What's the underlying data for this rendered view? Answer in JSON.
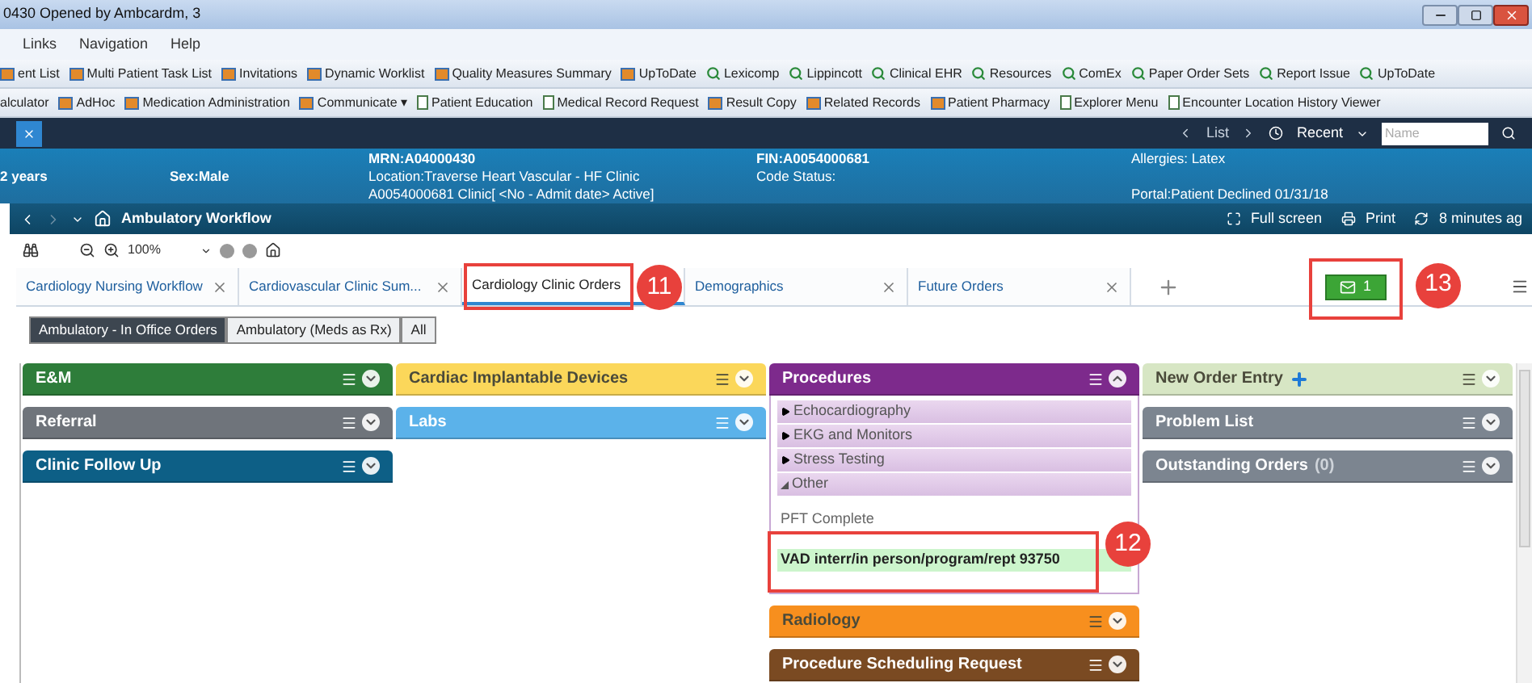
{
  "window": {
    "title": "0430 Opened by Ambcardm, 3"
  },
  "menu": [
    "Links",
    "Navigation",
    "Help"
  ],
  "toolbar_1": [
    {
      "label": "ent List",
      "kind": "app"
    },
    {
      "label": "Multi Patient Task List",
      "kind": "app"
    },
    {
      "label": "Invitations",
      "kind": "app"
    },
    {
      "label": "Dynamic Worklist",
      "kind": "app"
    },
    {
      "label": "Quality Measures Summary",
      "kind": "app"
    },
    {
      "label": "UpToDate",
      "kind": "app"
    },
    {
      "label": "Lexicomp",
      "kind": "link"
    },
    {
      "label": "Lippincott",
      "kind": "link"
    },
    {
      "label": "Clinical EHR",
      "kind": "link"
    },
    {
      "label": "Resources",
      "kind": "link"
    },
    {
      "label": "ComEx",
      "kind": "link"
    },
    {
      "label": "Paper Order Sets",
      "kind": "link"
    },
    {
      "label": "Report Issue",
      "kind": "link"
    },
    {
      "label": "UpToDate",
      "kind": "link"
    }
  ],
  "toolbar_2": [
    {
      "label": "alculator",
      "kind": "plain"
    },
    {
      "label": "AdHoc",
      "kind": "app"
    },
    {
      "label": "Medication Administration",
      "kind": "app"
    },
    {
      "label": "Communicate ▾",
      "kind": "app"
    },
    {
      "label": "Patient Education",
      "kind": "doc"
    },
    {
      "label": "Medical Record Request",
      "kind": "doc"
    },
    {
      "label": "Result Copy",
      "kind": "app"
    },
    {
      "label": "Related Records",
      "kind": "app"
    },
    {
      "label": "Patient Pharmacy",
      "kind": "app"
    },
    {
      "label": "Explorer Menu",
      "kind": "doc"
    },
    {
      "label": "Encounter Location History Viewer",
      "kind": "doc"
    }
  ],
  "nav_bar": {
    "list": "List",
    "recent": "Recent",
    "name_field": {
      "placeholder": "Name"
    }
  },
  "banner": {
    "age": "2 years",
    "sex": "Sex:Male",
    "mrn": "MRN:A04000430",
    "location": "Location:Traverse Heart  Vascular - HF Clinic",
    "encounter": "A0054000681 Clinic[ <No - Admit date> Active]",
    "fin": "FIN:A0054000681",
    "code_status": "Code Status:",
    "allergies": "Allergies: Latex",
    "portal": "Portal:Patient Declined 01/31/18"
  },
  "workflow_bar": {
    "title": "Ambulatory Workflow",
    "full_screen": "Full screen",
    "print": "Print",
    "refresh": "8 minutes ag"
  },
  "zoom": "100%",
  "tabs": [
    {
      "label": "Cardiology Nursing Workflow",
      "selected": false
    },
    {
      "label": "Cardiovascular Clinic Sum...",
      "selected": false
    },
    {
      "label": "Cardiology Clinic Orders",
      "selected": true,
      "callout": "11"
    },
    {
      "label": "Demographics",
      "selected": false
    },
    {
      "label": "Future Orders",
      "selected": false
    }
  ],
  "messages": {
    "count": "1",
    "callout": "13"
  },
  "filters": [
    {
      "label": "Ambulatory - In Office Orders",
      "selected": true
    },
    {
      "label": "Ambulatory (Meds as Rx)",
      "selected": false
    },
    {
      "label": "All",
      "selected": false
    }
  ],
  "columns": [
    [
      {
        "title": "E&M",
        "color": "#2e7d3a",
        "expanded": false
      },
      {
        "title": "Referral",
        "color": "#6f747b",
        "expanded": false
      },
      {
        "title": "Clinic Follow Up",
        "color": "#0d5f86",
        "expanded": false
      }
    ],
    [
      {
        "title": "Cardiac Implantable Devices",
        "color": "#fbd75a",
        "expanded": false
      },
      {
        "title": "Labs",
        "color": "#5bb2ea",
        "expanded": false
      }
    ],
    [
      {
        "title": "Procedures",
        "color": "#7d2a8c",
        "expanded": true,
        "sections": [
          {
            "label": "Echocardiography",
            "expanded": false
          },
          {
            "label": "EKG and Monitors",
            "expanded": false
          },
          {
            "label": "Stress Testing",
            "expanded": false
          },
          {
            "label": "Other",
            "expanded": true,
            "items": [
              {
                "label": "PFT Complete",
                "selected": false
              },
              {
                "label": "VAD interr/in person/program/rept 93750",
                "selected": true,
                "callout": "12"
              }
            ]
          }
        ]
      },
      {
        "title": "Radiology",
        "color": "#f78f1e",
        "expanded": false
      },
      {
        "title": "Procedure Scheduling Request",
        "color": "#7a4a22",
        "expanded": false
      }
    ],
    [
      {
        "title": "New Order Entry",
        "color": "#d7e6c4",
        "expanded": false,
        "add": true
      },
      {
        "title": "Problem List",
        "color": "#7c8590",
        "expanded": false
      },
      {
        "title": "Outstanding Orders",
        "count": "(0)",
        "color": "#7c8590",
        "expanded": false
      }
    ]
  ]
}
